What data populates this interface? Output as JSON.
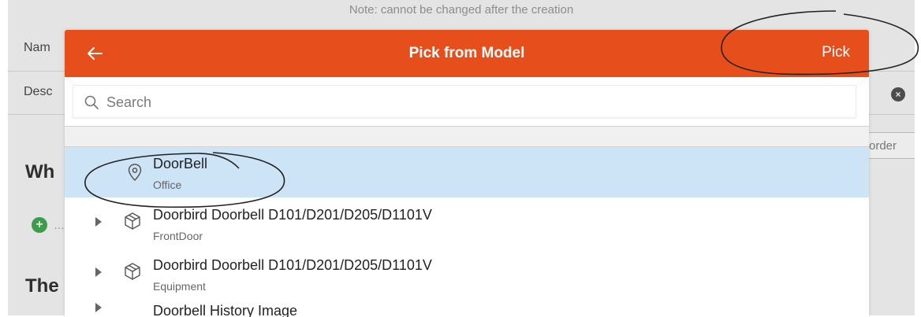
{
  "background": {
    "note": "Note: cannot be changed after the creation",
    "name_label": "Nam",
    "description_label": "Desc",
    "order_button": "order",
    "heading_1": "Wh",
    "heading_2": "The",
    "clear_icon": "clear-circle-icon",
    "add_icon": "add-circle-icon"
  },
  "modal": {
    "title": "Pick from Model",
    "back_icon": "arrow-left-icon",
    "pick_label": "Pick",
    "search": {
      "placeholder": "Search",
      "value": "",
      "icon": "search-icon"
    },
    "items": [
      {
        "title": "DoorBell",
        "subtitle": "Office",
        "icon": "location-pin-icon",
        "selected": true,
        "expandable": false
      },
      {
        "title": "Doorbird Doorbell D101/D201/D205/D1101V",
        "subtitle": "FrontDoor",
        "icon": "cube-icon",
        "selected": false,
        "expandable": true
      },
      {
        "title": "Doorbird Doorbell D101/D201/D205/D1101V",
        "subtitle": "Equipment",
        "icon": "cube-icon",
        "selected": false,
        "expandable": true
      },
      {
        "title": "Doorbell History Image",
        "subtitle": "",
        "icon": "cube-icon",
        "selected": false,
        "expandable": true
      }
    ]
  },
  "colors": {
    "header": "#e64f1c",
    "selected_row": "#cde3f6",
    "backdrop": "#e4e4e4"
  }
}
